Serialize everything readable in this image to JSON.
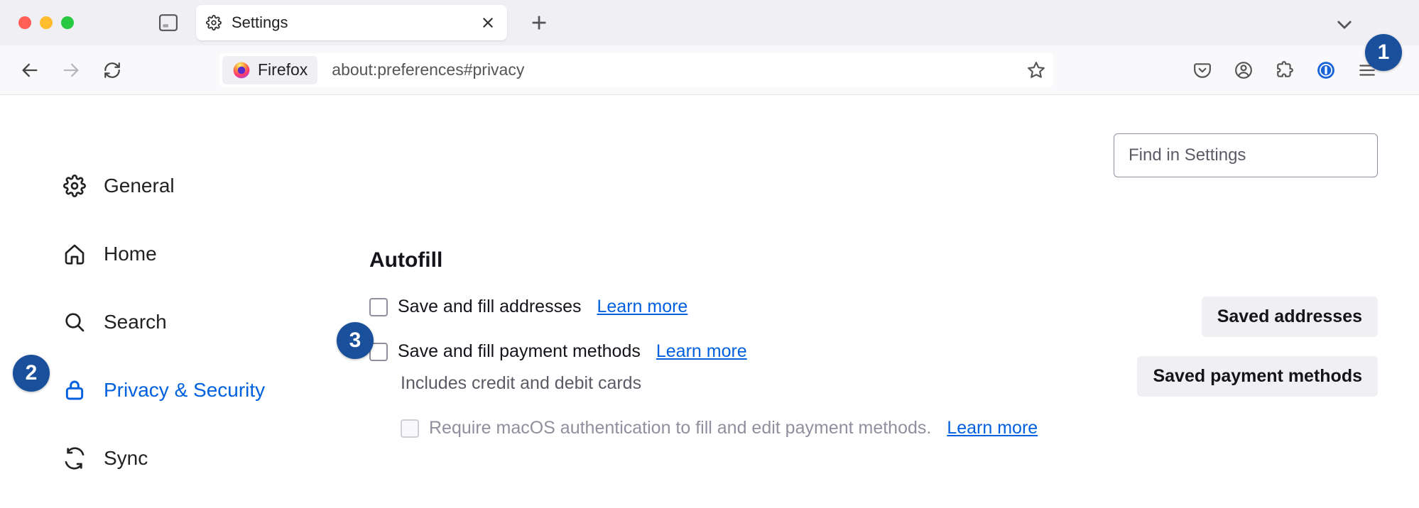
{
  "tab": {
    "title": "Settings"
  },
  "toolbar": {
    "identity_label": "Firefox",
    "url": "about:preferences#privacy"
  },
  "find": {
    "placeholder": "Find in Settings"
  },
  "sidebar": {
    "items": [
      {
        "label": "General"
      },
      {
        "label": "Home"
      },
      {
        "label": "Search"
      },
      {
        "label": "Privacy & Security"
      },
      {
        "label": "Sync"
      }
    ]
  },
  "section": {
    "title": "Autofill"
  },
  "prefs": {
    "addresses": {
      "label": "Save and fill addresses",
      "learn": "Learn more",
      "button": "Saved addresses"
    },
    "payments": {
      "label": "Save and fill payment methods",
      "learn": "Learn more",
      "button": "Saved payment methods",
      "help": "Includes credit and debit cards",
      "require": "Require macOS authentication to fill and edit payment methods.",
      "require_learn": "Learn more"
    }
  },
  "callouts": {
    "c1": "1",
    "c2": "2",
    "c3": "3"
  }
}
